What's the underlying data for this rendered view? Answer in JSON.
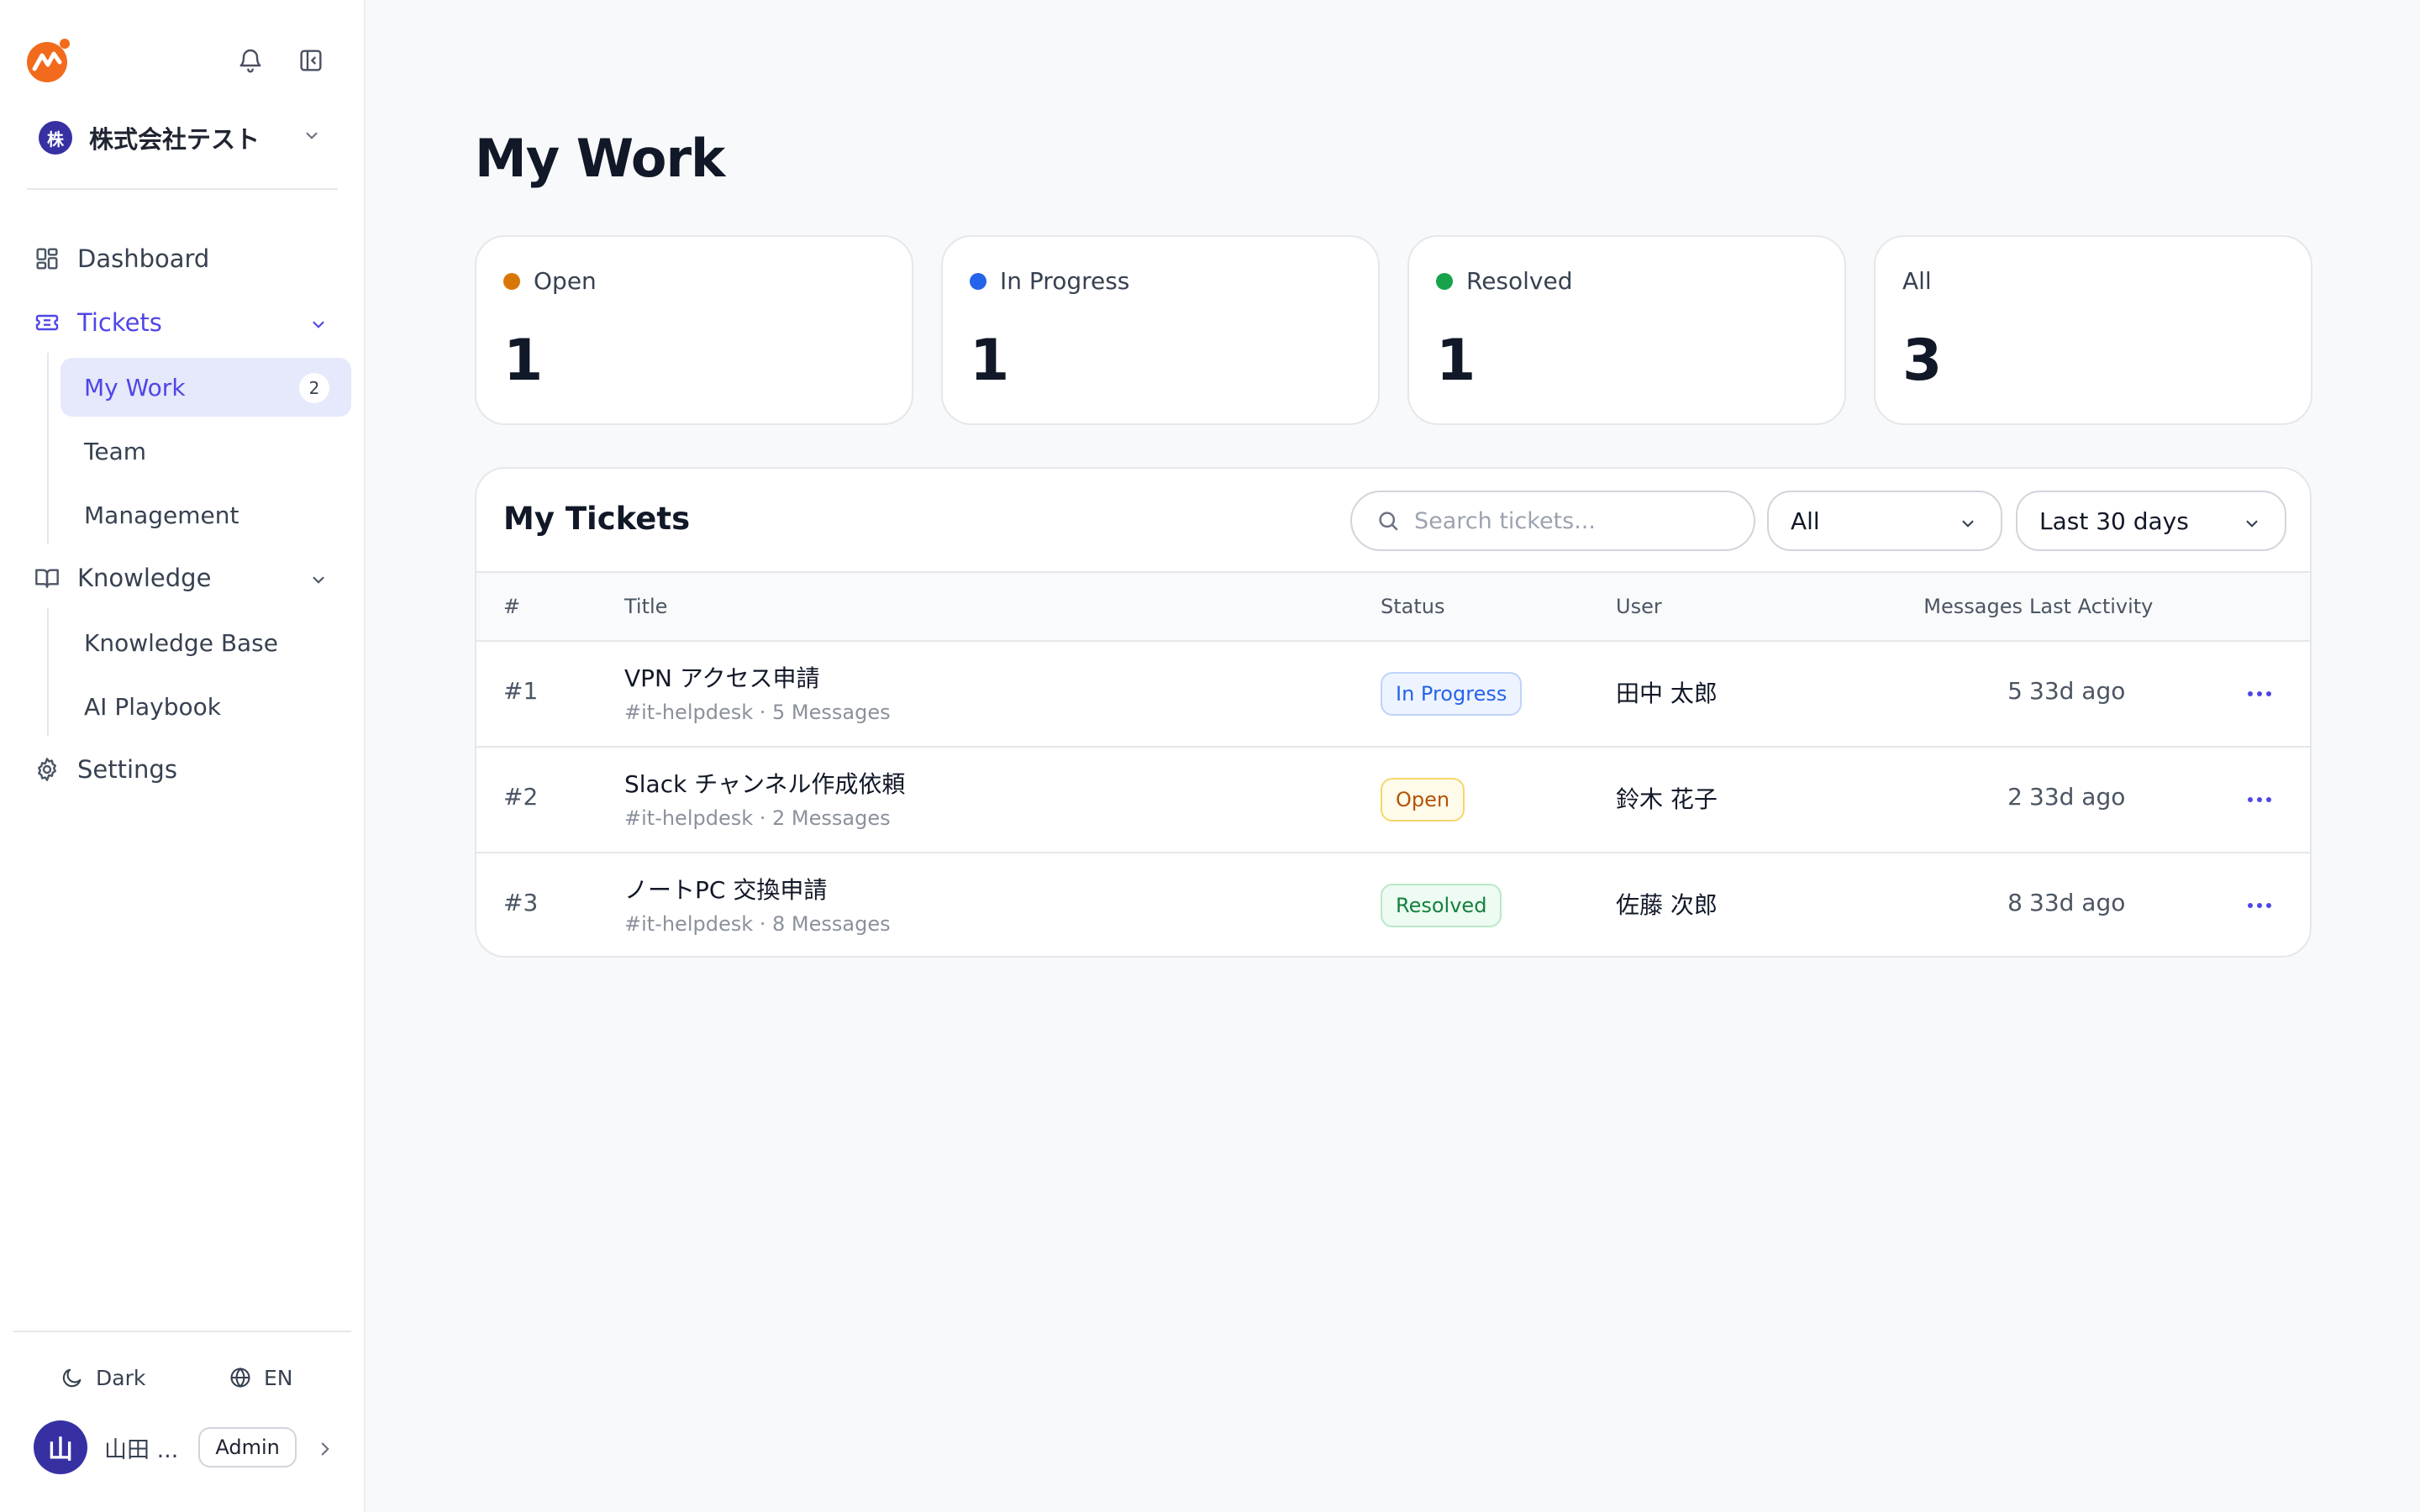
{
  "app": {
    "org_initial": "株",
    "org_name": "株式会社テスト"
  },
  "sidebar": {
    "dashboard": "Dashboard",
    "tickets": "Tickets",
    "tickets_sub": {
      "my_work": "My Work",
      "my_work_count": "2",
      "team": "Team",
      "management": "Management"
    },
    "knowledge": "Knowledge",
    "knowledge_sub": {
      "knowledge_base": "Knowledge Base",
      "ai_playbook": "AI Playbook"
    },
    "settings": "Settings",
    "theme_label": "Dark",
    "language_label": "EN",
    "user_initial": "山",
    "user_name": "山田 ...",
    "user_role": "Admin"
  },
  "page": {
    "title": "My Work"
  },
  "stats": [
    {
      "label": "Open",
      "value": "1",
      "color": "#d97706"
    },
    {
      "label": "In Progress",
      "value": "1",
      "color": "#2563eb"
    },
    {
      "label": "Resolved",
      "value": "1",
      "color": "#16a34a"
    },
    {
      "label": "All",
      "value": "3"
    }
  ],
  "tickets_table": {
    "title": "My Tickets",
    "search_placeholder": "Search tickets...",
    "status_filter": "All",
    "range_filter": "Last 30 days",
    "columns": {
      "id": "#",
      "title": "Title",
      "status": "Status",
      "user": "User",
      "messages": "Messages",
      "last_activity": "Last Activity"
    },
    "rows": [
      {
        "id": "#1",
        "title": "VPN アクセス申請",
        "subtitle": "#it-helpdesk · 5 Messages",
        "status": "In Progress",
        "user": "田中 太郎",
        "messages": "5",
        "last_activity": "33d ago"
      },
      {
        "id": "#2",
        "title": "Slack チャンネル作成依頼",
        "subtitle": "#it-helpdesk · 2 Messages",
        "status": "Open",
        "user": "鈴木 花子",
        "messages": "2",
        "last_activity": "33d ago"
      },
      {
        "id": "#3",
        "title": "ノートPC 交換申請",
        "subtitle": "#it-helpdesk · 8 Messages",
        "status": "Resolved",
        "user": "佐藤 次郎",
        "messages": "8",
        "last_activity": "33d ago"
      }
    ]
  }
}
